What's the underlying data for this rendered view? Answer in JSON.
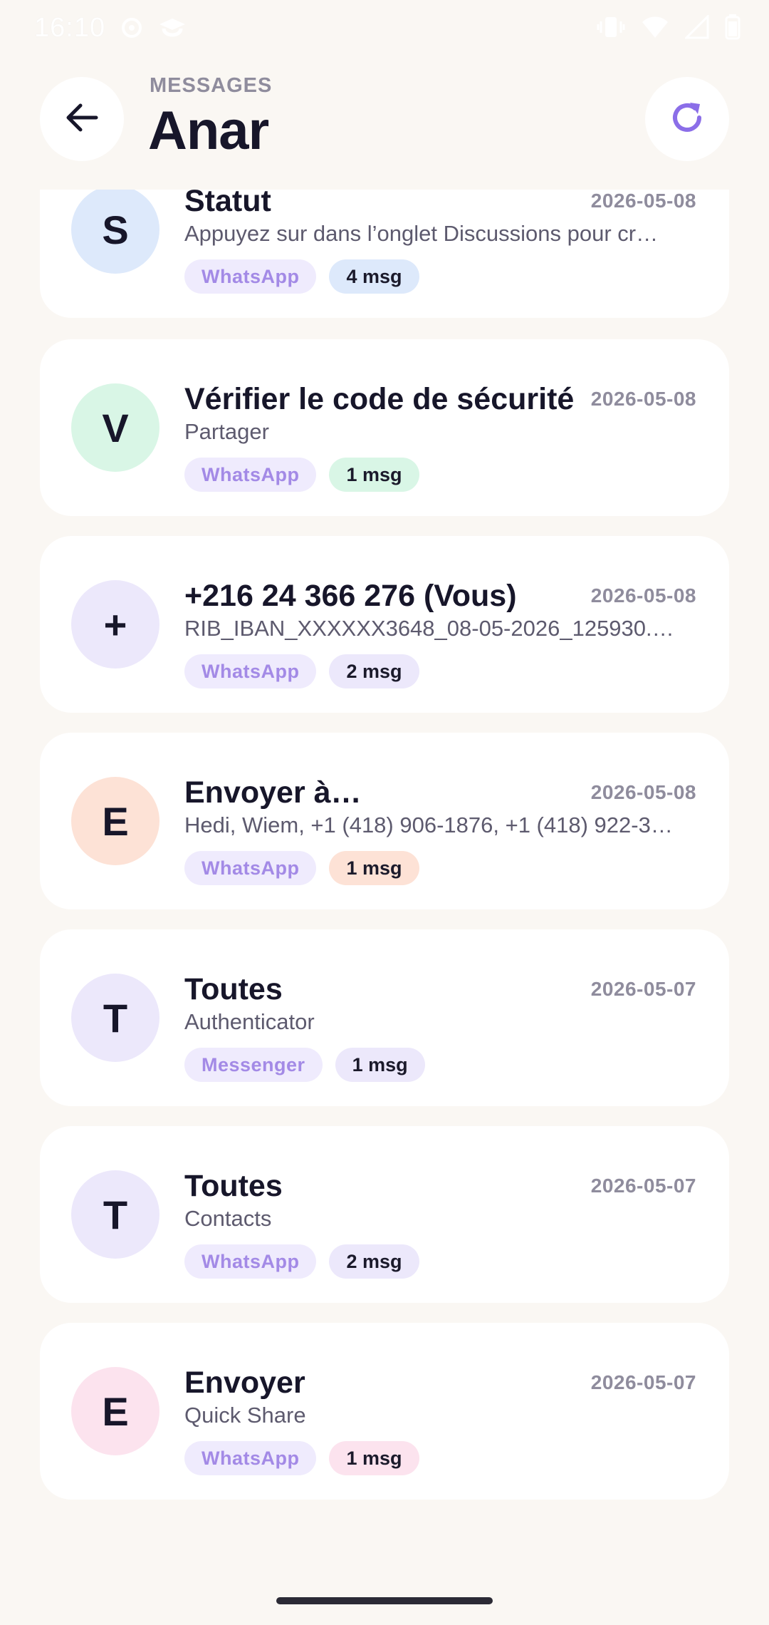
{
  "status_bar": {
    "time": "16:10"
  },
  "header": {
    "subtitle": "MESSAGES",
    "title": "Anar"
  },
  "colors": {
    "accent": "#8b6ee8",
    "background": "#faf7f3",
    "card": "#ffffff"
  },
  "conversations": [
    {
      "initial": "S",
      "title": "Statut",
      "date": "2026-05-08",
      "preview": "Appuyez sur  dans l’onglet Discussions pour cr…",
      "app": "WhatsApp",
      "count": "4 msg",
      "avatar_color": "#dde9fb",
      "badge_color": "#dde9fb"
    },
    {
      "initial": "V",
      "title": "Vérifier le code de sécurité",
      "date": "2026-05-08",
      "preview": "Partager",
      "app": "WhatsApp",
      "count": "1 msg",
      "avatar_color": "#d9f6e6",
      "badge_color": "#d9f6e6"
    },
    {
      "initial": "+",
      "title": "+216 24 366 276 (Vous)",
      "date": "2026-05-08",
      "preview": "RIB_IBAN_XXXXXX3648_08-05-2026_125930.…",
      "app": "WhatsApp",
      "count": "2 msg",
      "avatar_color": "#ece8fb",
      "badge_color": "#ece8fb"
    },
    {
      "initial": "E",
      "title": "Envoyer à…",
      "date": "2026-05-08",
      "preview": "Hedi, Wiem, +1 (418) 906-1876, +1 (418) 922-3…",
      "app": "WhatsApp",
      "count": "1 msg",
      "avatar_color": "#fde2d6",
      "badge_color": "#fde2d6"
    },
    {
      "initial": "T",
      "title": "Toutes",
      "date": "2026-05-07",
      "preview": "Authenticator",
      "app": "Messenger",
      "count": "1 msg",
      "avatar_color": "#ece8fb",
      "badge_color": "#ece8fb"
    },
    {
      "initial": "T",
      "title": "Toutes",
      "date": "2026-05-07",
      "preview": "Contacts",
      "app": "WhatsApp",
      "count": "2 msg",
      "avatar_color": "#ece8fb",
      "badge_color": "#ece8fb"
    },
    {
      "initial": "E",
      "title": "Envoyer",
      "date": "2026-05-07",
      "preview": "Quick Share",
      "app": "WhatsApp",
      "count": "1 msg",
      "avatar_color": "#fce3ee",
      "badge_color": "#fce3ee"
    }
  ]
}
